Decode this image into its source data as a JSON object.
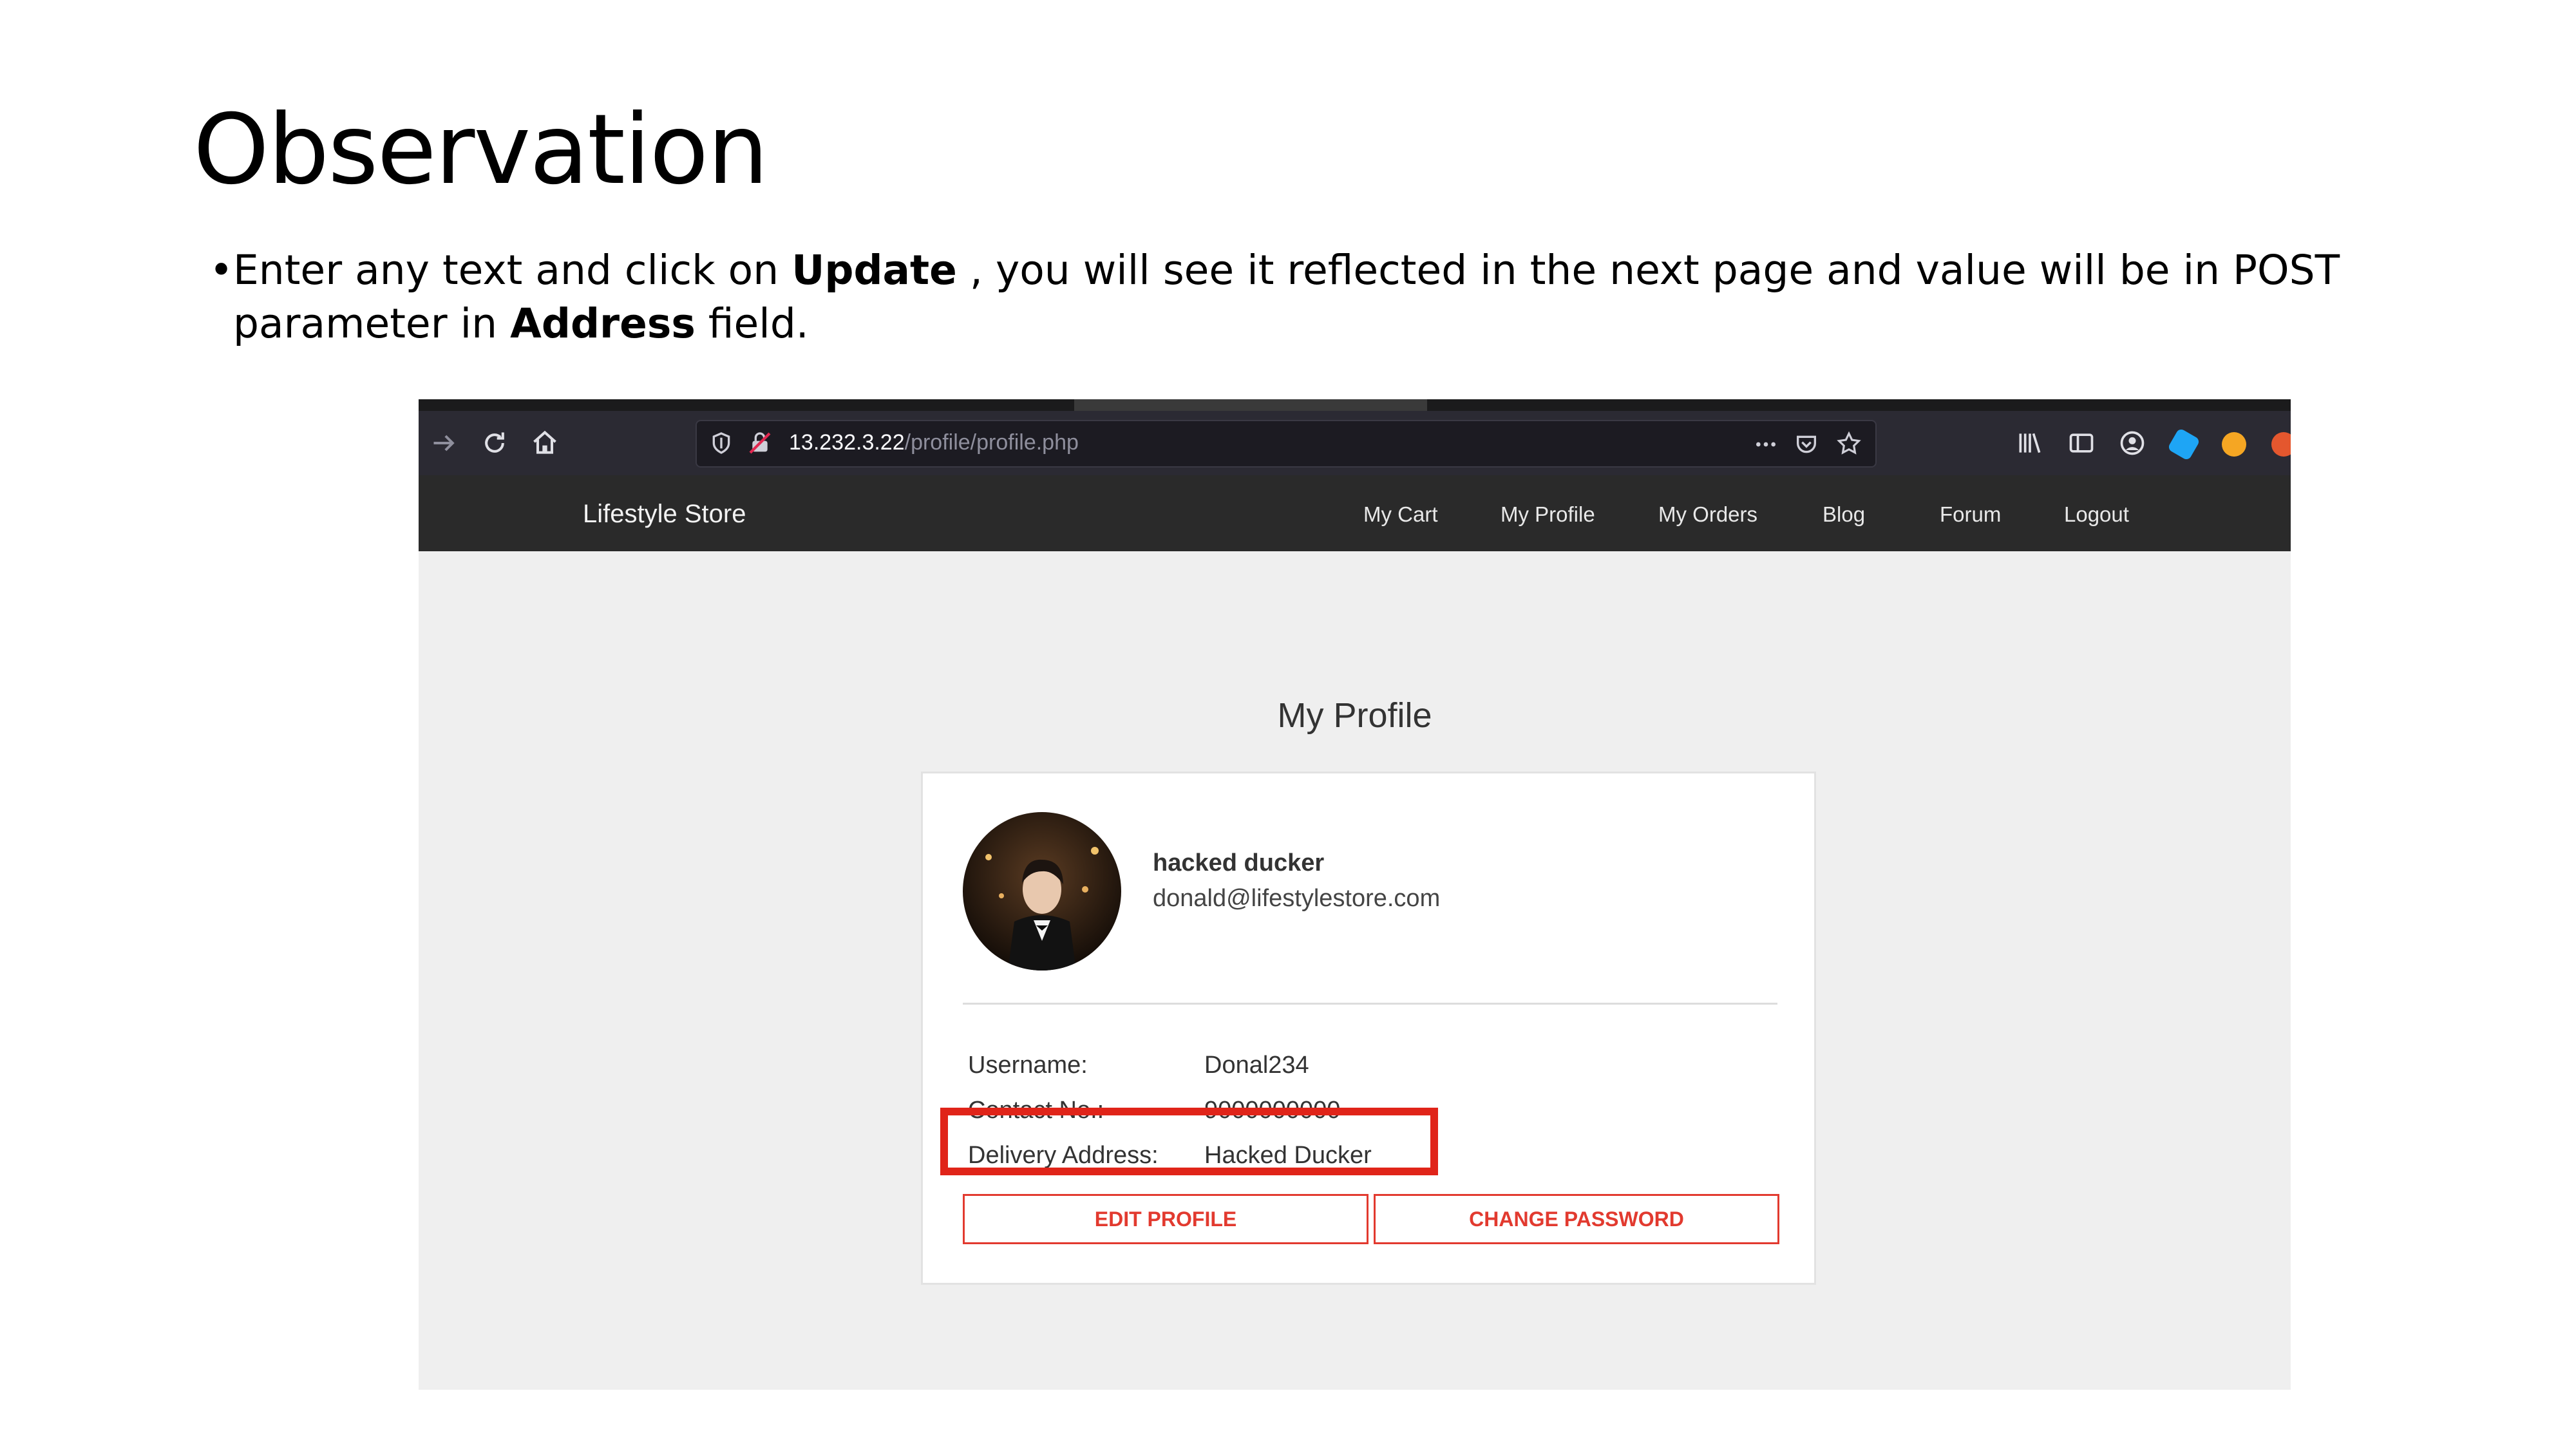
{
  "slide": {
    "title": "Observation",
    "bullet": {
      "symbol": "•",
      "part1": "Enter any text and click on ",
      "bold1": "Update",
      "part2": " , you will see it reflected in the next page and value will be in POST parameter in ",
      "bold2": "Address",
      "part3": " field."
    }
  },
  "browser": {
    "url_host": "13.232.3.22",
    "url_path": "/profile/profile.php",
    "icons": [
      "forward-icon",
      "reload-icon",
      "home-icon",
      "shield-icon",
      "insecure-lock-icon",
      "more-icon",
      "pocket-icon",
      "bookmark-star-icon",
      "library-icon",
      "sidebar-icon",
      "account-icon",
      "extension-blue-icon",
      "extension-orange-icon",
      "extension-fox-icon"
    ]
  },
  "site": {
    "brand": "Lifestyle Store",
    "nav": [
      "My Cart",
      "My Profile",
      "My Orders",
      "Blog",
      "Forum",
      "Logout"
    ]
  },
  "profile": {
    "heading": "My Profile",
    "name": "hacked ducker",
    "email": "donald@lifestylestore.com",
    "username_label": "Username:",
    "username": "Donal234",
    "contact_label": "Contact No.:",
    "contact": "9000000000",
    "address_label": "Delivery Address:",
    "address": "Hacked Ducker",
    "edit_button": "EDIT PROFILE",
    "password_button": "CHANGE PASSWORD"
  },
  "colors": {
    "highlight": "#e02419",
    "button_accent": "#e23a2f",
    "navbar": "#2a2a2a"
  }
}
